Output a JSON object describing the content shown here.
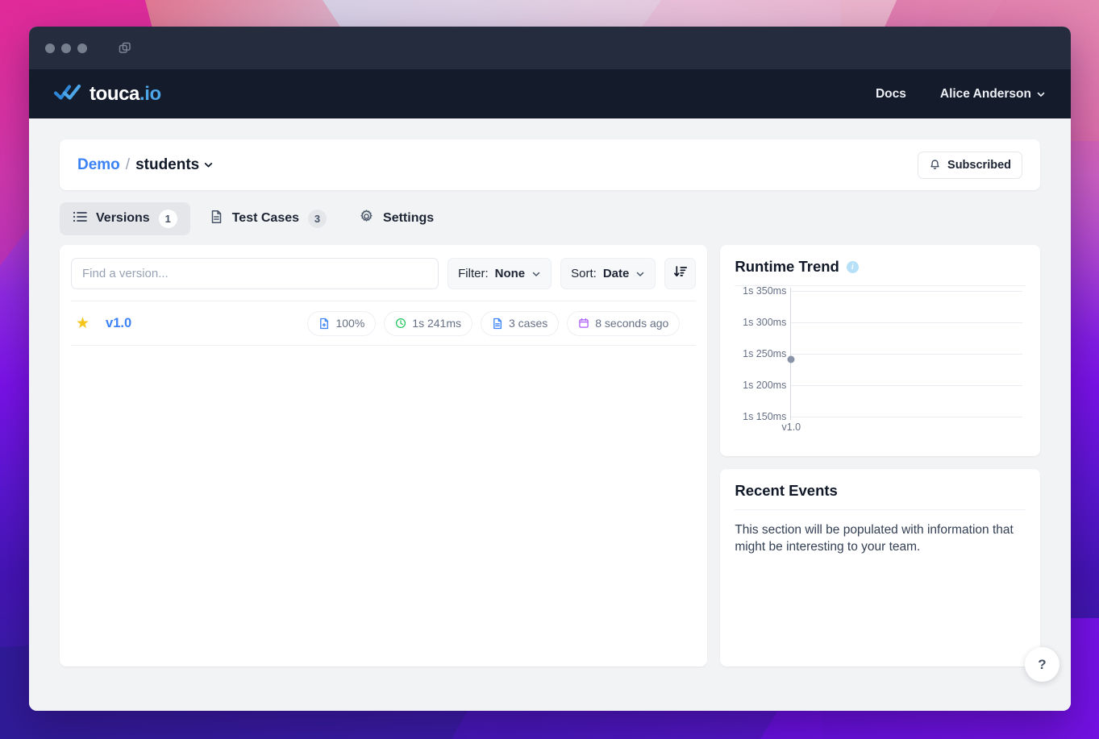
{
  "window": {
    "titlebar": {
      "traffic_dots": 3,
      "tab_icon": "windows-copy-icon"
    }
  },
  "appbar": {
    "logo_main": "touca",
    "logo_suffix": ".io",
    "logo_icon": "double-check-icon",
    "nav": {
      "docs": "Docs",
      "user": "Alice Anderson",
      "user_chevron": "chevron-down-icon"
    }
  },
  "breadcrumb": {
    "team": "Demo",
    "separator": "/",
    "suite": "students",
    "subscribe_label": "Subscribed",
    "subscribe_icon": "bell-icon"
  },
  "tabs": [
    {
      "label": "Versions",
      "badge": "1",
      "icon": "list-icon",
      "active": true
    },
    {
      "label": "Test Cases",
      "badge": "3",
      "icon": "document-icon",
      "active": false
    },
    {
      "label": "Settings",
      "badge": "",
      "icon": "gear-icon",
      "active": false
    }
  ],
  "filterbar": {
    "search_placeholder": "Find a version...",
    "search_value": "",
    "filter_label": "Filter:",
    "filter_value": "None",
    "sort_label": "Sort:",
    "sort_value": "Date",
    "sort_direction_icon": "sort-amount-down-icon"
  },
  "versions": [
    {
      "star": "★",
      "name": "v1.0",
      "pills": [
        {
          "icon": "file-plus-icon",
          "label": "100%",
          "color": "#3b82f6"
        },
        {
          "icon": "clock-icon",
          "label": "1s 241ms",
          "color": "#22c55e"
        },
        {
          "icon": "file-icon",
          "label": "3 cases",
          "color": "#3b82f6"
        },
        {
          "icon": "calendar-icon",
          "label": "8 seconds ago",
          "color": "#a855f7"
        }
      ]
    }
  ],
  "runtime_card": {
    "title": "Runtime Trend",
    "info_icon": "info-icon",
    "info_glyph": "i"
  },
  "chart_data": {
    "type": "scatter",
    "title": "Runtime Trend",
    "xlabel": "",
    "ylabel": "",
    "categories": [
      "v1.0"
    ],
    "x": [
      "v1.0"
    ],
    "values": [
      1241
    ],
    "value_labels": [
      "1s 241ms"
    ],
    "ytick_values": [
      1150,
      1200,
      1250,
      1300,
      1350
    ],
    "ytick_labels": [
      "1s 150ms",
      "1s 200ms",
      "1s 250ms",
      "1s 300ms",
      "1s 350ms"
    ],
    "ylim": [
      1150,
      1350
    ],
    "grid": true,
    "legend": false,
    "point_color": "#8a93a8"
  },
  "events_card": {
    "title": "Recent Events",
    "body": "This section will be populated with information that might be interesting to your team."
  },
  "help": {
    "label": "?"
  }
}
